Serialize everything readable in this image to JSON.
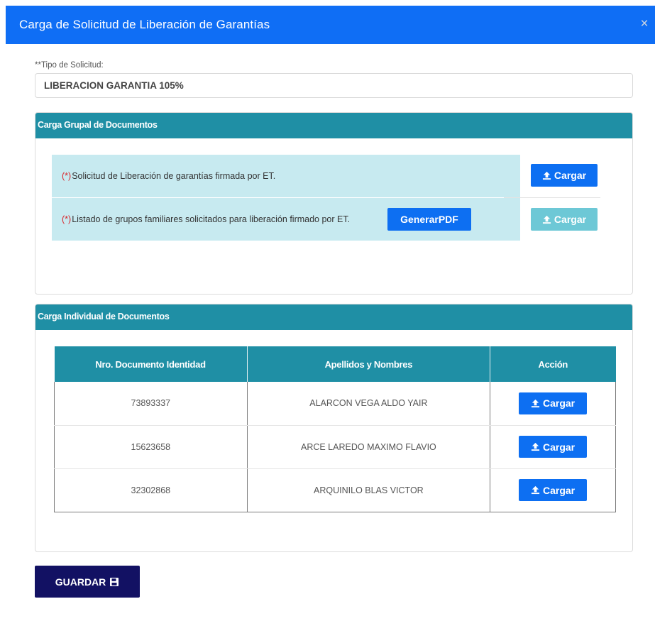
{
  "modal": {
    "title": "Carga de Solicitud de Liberación de Garantías",
    "close_symbol": "×"
  },
  "tipo_solicitud": {
    "label": "**Tipo de Solicitud:",
    "value": "LIBERACION GARANTIA 105%"
  },
  "carga_grupal": {
    "heading": "Carga Grupal de Documentos",
    "items": [
      {
        "required_mark": "(*)",
        "label": "Solicitud de Liberación de garantías firmada por ET.",
        "button_label": "Cargar",
        "button_enabled": true
      },
      {
        "required_mark": "(*)",
        "label": "Listado de grupos familiares solicitados para liberación firmado por ET.",
        "extra_button_label": "GenerarPDF",
        "button_label": "Cargar",
        "button_enabled": false
      }
    ]
  },
  "carga_individual": {
    "heading": "Carga Individual de Documentos",
    "columns": [
      "Nro. Documento Identidad",
      "Apellidos y Nombres",
      "Acción"
    ],
    "rows": [
      {
        "documento": "73893337",
        "nombre": "ALARCON VEGA ALDO YAIR",
        "action_label": "Cargar"
      },
      {
        "documento": "15623658",
        "nombre": "ARCE LAREDO MAXIMO FLAVIO",
        "action_label": "Cargar"
      },
      {
        "documento": "32302868",
        "nombre": "ARQUINILO BLAS VICTOR",
        "action_label": "Cargar"
      }
    ]
  },
  "footer": {
    "save_label": "GUARDAR"
  },
  "colors": {
    "header_blue": "#0f6ef5",
    "panel_teal": "#1f8fa5",
    "button_blue": "#0d6ff2",
    "button_disabled": "#6dc8d6",
    "row_highlight": "#c7eaf0",
    "save_navy": "#121163",
    "required_red": "#d9262b"
  },
  "icons": {
    "upload": "upload-icon",
    "save": "floppy-disk-icon",
    "close": "close-icon"
  }
}
